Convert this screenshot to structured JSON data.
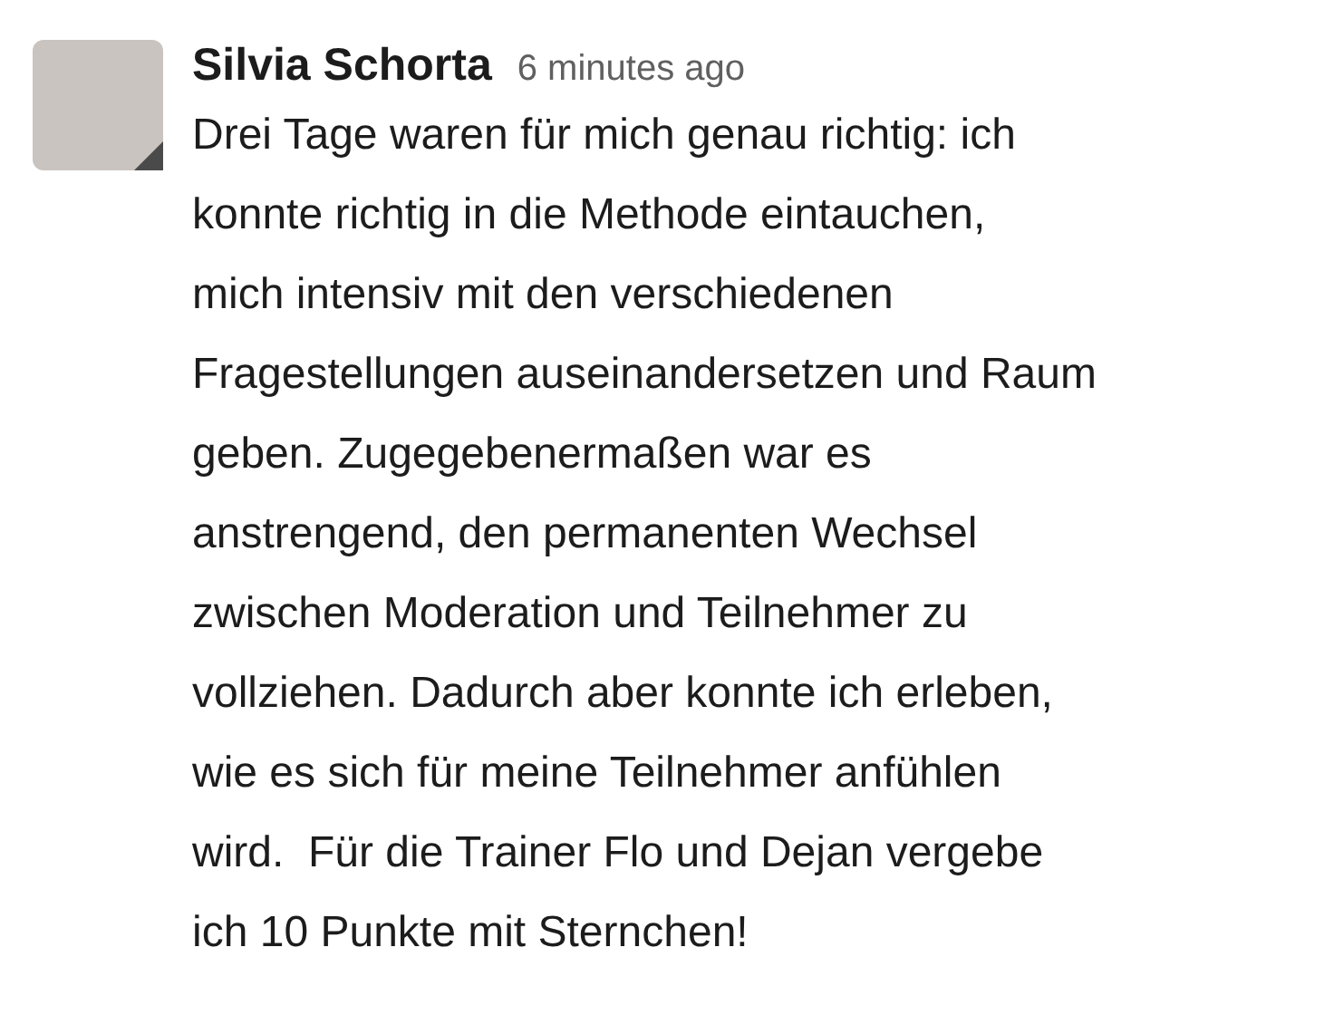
{
  "message": {
    "author": "Silvia Schorta",
    "timestamp": "6 minutes ago",
    "lines": [
      "Drei Tage waren für mich genau richtig: ich",
      "konnte richtig in die Methode eintauchen,",
      "mich intensiv mit den verschiedenen",
      "Fragestellungen auseinandersetzen und Raum",
      "geben. Zugegebenermaßen war es",
      "anstrengend, den permanenten Wechsel",
      "zwischen Moderation und Teilnehmer zu",
      "vollziehen. Dadurch aber konnte ich erleben,",
      "wie es sich für meine Teilnehmer anfühlen",
      "wird.  Für die Trainer Flo und Dejan vergebe",
      "ich 10 Punkte mit Sternchen!"
    ]
  }
}
